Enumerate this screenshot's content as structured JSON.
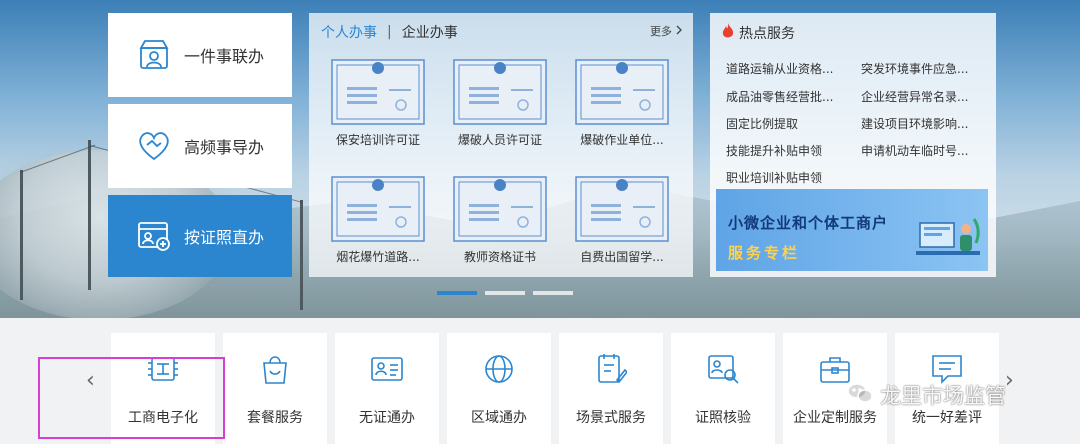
{
  "left_menu": [
    {
      "label": "一件事联办",
      "icon": "people-service-icon"
    },
    {
      "label": "高频事导办",
      "icon": "handshake-heart-icon"
    },
    {
      "label": "按证照直办",
      "icon": "id-card-add-icon"
    }
  ],
  "center_panel": {
    "tab_personal": "个人办事",
    "tab_separator": "|",
    "tab_enterprise": "企业办事",
    "more_label": "更多",
    "certs": [
      "保安培训许可证",
      "爆破人员许可证",
      "爆破作业单位...",
      "烟花爆竹道路...",
      "教师资格证书",
      "自费出国留学..."
    ]
  },
  "hot_services": {
    "title": "热点服务",
    "items": [
      "道路运输从业资格...",
      "突发环境事件应急...",
      "成品油零售经营批...",
      "企业经营异常名录...",
      "固定比例提取",
      "建设项目环境影响...",
      "技能提升补贴申领",
      "申请机动车临时号...",
      "职业培训补贴申领"
    ],
    "banner_line1": "小微企业和个体工商户",
    "banner_line2": "服务专栏"
  },
  "bottom_services": [
    "工商电子化",
    "套餐服务",
    "无证通办",
    "区域通办",
    "场景式服务",
    "证照核验",
    "企业定制服务",
    "统一好差评"
  ],
  "watermark": "龙里市场监管",
  "colors": {
    "accent": "#2b86cf",
    "highlight": "#d63fd3",
    "flame": "#e8412e",
    "banner_yellow": "#ffd24a"
  }
}
